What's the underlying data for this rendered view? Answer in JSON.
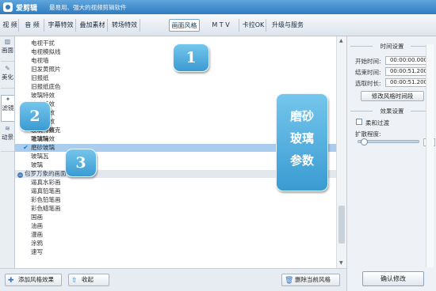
{
  "app": {
    "name": "爱剪辑",
    "slogan": "最易用、强大的视频剪辑软件"
  },
  "top_tabs": [
    "视 频",
    "音 频",
    "字幕特效",
    "叠加素材",
    "转场特效",
    "画面风格",
    "M T V",
    "卡拉OK",
    "升级与服务"
  ],
  "side_tabs": [
    {
      "label": "画面",
      "icon": "picture-icon"
    },
    {
      "label": "美化",
      "icon": "brush-icon"
    },
    {
      "label": "滤镜",
      "icon": "wand-icon"
    },
    {
      "label": "动景",
      "icon": "waves-icon"
    }
  ],
  "effects_list": {
    "items_before": [
      "电视干扰",
      "电视模拟线",
      "电视墙",
      "旧发黄照片",
      "旧报纸",
      "旧报纸底色"
    ],
    "items_middle": [
      "玻璃特效",
      "玻璃特效",
      "玻璃特效",
      "玻璃特效",
      "玻璃特效",
      "玻璃特效"
    ],
    "items_near": [
      "玻璃马赛克",
      "毛玻璃"
    ],
    "selected": "磨砂玻璃",
    "items_after": [
      "玻璃瓦",
      "玻璃"
    ],
    "group": "包罗万象的画面",
    "group_items": [
      "逼真水彩画",
      "逼真铅笔画",
      "彩色铅笔画",
      "彩色蜡笔画",
      "国画",
      "油画",
      "漫画",
      "涂鸦",
      "速写"
    ]
  },
  "callouts": {
    "n1": "1",
    "n2": "2",
    "n3": "3",
    "text": [
      "磨砂",
      "玻璃",
      "参数"
    ]
  },
  "bottom_buttons": {
    "add": "添加风格效果",
    "collapse": "收起",
    "delete": "删除当前风格"
  },
  "time_settings": {
    "title": "时间设置",
    "start_label": "开始时间:",
    "start_value": "00:00:00.000",
    "end_label": "结束时间:",
    "end_value": "00:00:51.200",
    "duration_label": "选取时长:",
    "duration_value": "00:00:51.200",
    "modify_button": "修改风格时间段"
  },
  "effect_settings": {
    "title": "效果设置",
    "soft_transition_label": "柔和过渡",
    "soft_transition_checked": false,
    "diffusion_label": "扩散程度:",
    "diffusion_value": "8",
    "diffusion_fraction": 0.08
  },
  "confirm_button": "确认修改"
}
